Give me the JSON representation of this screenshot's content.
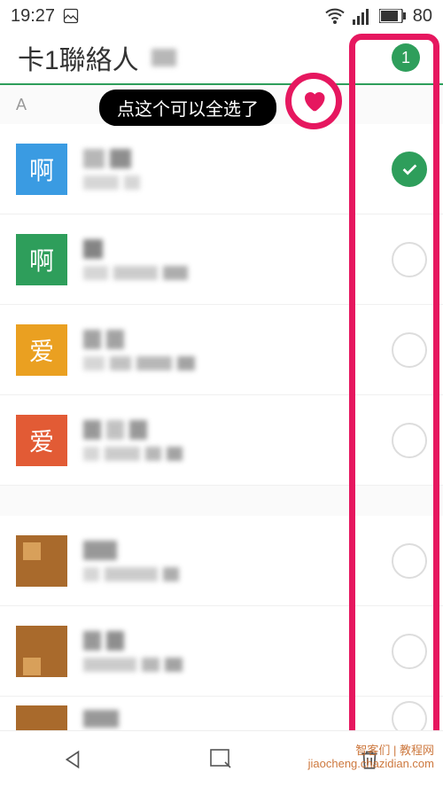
{
  "status": {
    "time": "19:27",
    "battery": "80"
  },
  "header": {
    "title": "卡1聯絡人",
    "badge_count": "1"
  },
  "section": {
    "letter": "A"
  },
  "tooltip": {
    "text": "点这个可以全选了"
  },
  "contacts": [
    {
      "avatar_text": "啊",
      "avatar_class": "avatar-blue",
      "checked": true
    },
    {
      "avatar_text": "啊",
      "avatar_class": "avatar-green",
      "checked": false
    },
    {
      "avatar_text": "爱",
      "avatar_class": "avatar-orange",
      "checked": false
    },
    {
      "avatar_text": "爱",
      "avatar_class": "avatar-red",
      "checked": false
    },
    {
      "avatar_text": "",
      "avatar_class": "avatar-brown",
      "checked": false
    },
    {
      "avatar_text": "",
      "avatar_class": "avatar-brown avatar-brown-2",
      "checked": false
    },
    {
      "avatar_text": "",
      "avatar_class": "avatar-brown avatar-brown-2",
      "checked": false
    }
  ],
  "watermark": {
    "line1": "智客们 | 教程网",
    "line2": "jiaocheng.chazidian.com"
  }
}
